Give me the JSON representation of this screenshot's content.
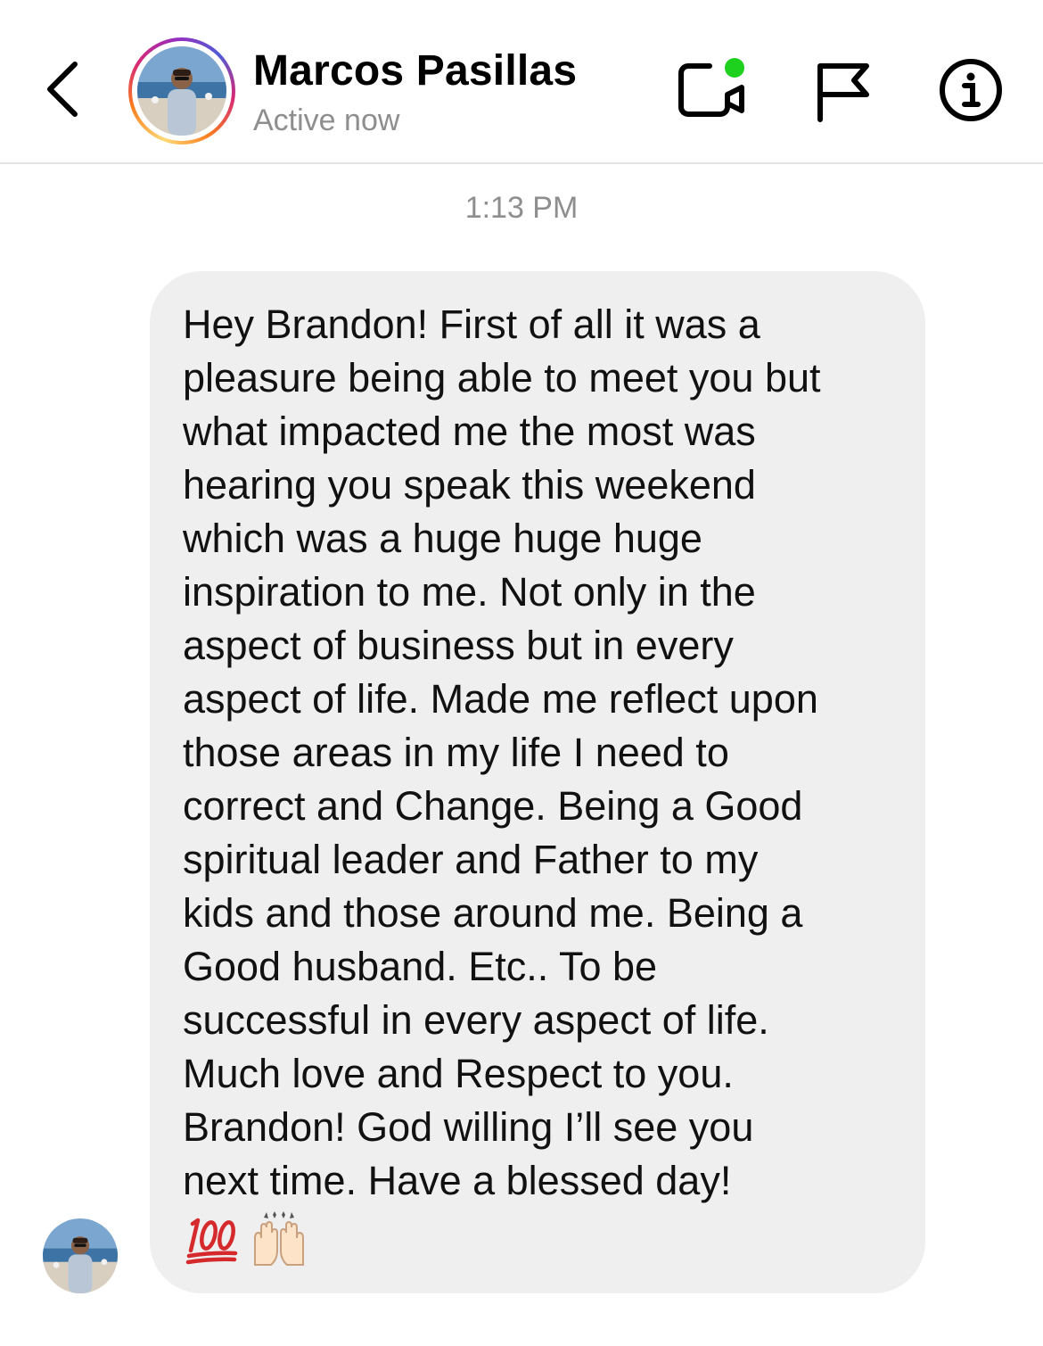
{
  "header": {
    "contact_name": "Marcos Pasillas",
    "status": "Active now"
  },
  "thread": {
    "timestamp": "1:13 PM",
    "message": {
      "text": "Hey Brandon! First of all it was a\npleasure being able to meet you but\nwhat impacted me the most was\nhearing you speak this weekend\nwhich was a huge huge huge\ninspiration to me. Not only in the\naspect of business but in every\naspect of life. Made me reflect upon\nthose areas in my life I need to\ncorrect and Change. Being a Good\nspiritual leader and Father to my\nkids and those around me. Being a\nGood husband. Etc.. To be\nsuccessful in every aspect of life.\nMuch love and Respect to you.\nBrandon! God willing I’ll see you\nnext time. Have a blessed day!",
      "emojis": [
        "hundred-points",
        "raising-hands"
      ]
    }
  },
  "colors": {
    "bubble": "#efefef",
    "secondary_text": "#8e8e8e",
    "online_dot": "#1ed11e",
    "divider": "#e3e3e3"
  },
  "icons": [
    "back-chevron-icon",
    "video-call-icon",
    "flag-icon",
    "info-icon",
    "hundred-points-emoji",
    "raising-hands-emoji"
  ]
}
